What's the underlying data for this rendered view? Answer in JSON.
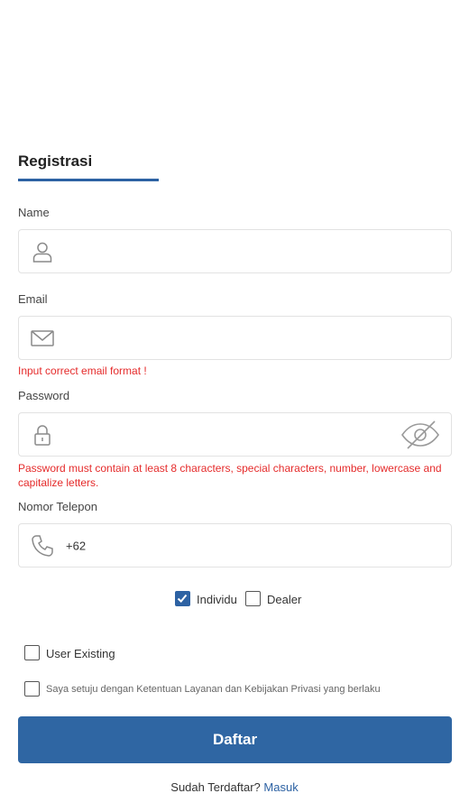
{
  "form": {
    "title": "Registrasi",
    "name": {
      "label": "Name",
      "value": ""
    },
    "email": {
      "label": "Email",
      "value": "",
      "error": "Input correct email format !"
    },
    "password": {
      "label": "Password",
      "value": "",
      "error": "Password must contain at least 8 characters, special characters, number, lowercase and capitalize letters."
    },
    "phone": {
      "label": "Nomor Telepon",
      "prefix": "+62"
    },
    "account_type": {
      "options": [
        {
          "label": "Individu",
          "checked": true
        },
        {
          "label": "Dealer",
          "checked": false
        }
      ]
    },
    "user_existing": {
      "label": "User Existing",
      "checked": false
    },
    "terms": {
      "label": "Saya setuju dengan Ketentuan Layanan dan Kebijakan Privasi yang berlaku",
      "checked": false
    },
    "submit_label": "Daftar"
  },
  "footer": {
    "prompt": "Sudah Terdaftar?",
    "login_link": "Masuk"
  },
  "colors": {
    "accent": "#2f66a3",
    "error": "#e52b2b",
    "border": "#e2e2e2"
  },
  "icons": [
    "user-icon",
    "mail-icon",
    "lock-icon",
    "eye-off-icon",
    "phone-icon",
    "check-icon"
  ]
}
